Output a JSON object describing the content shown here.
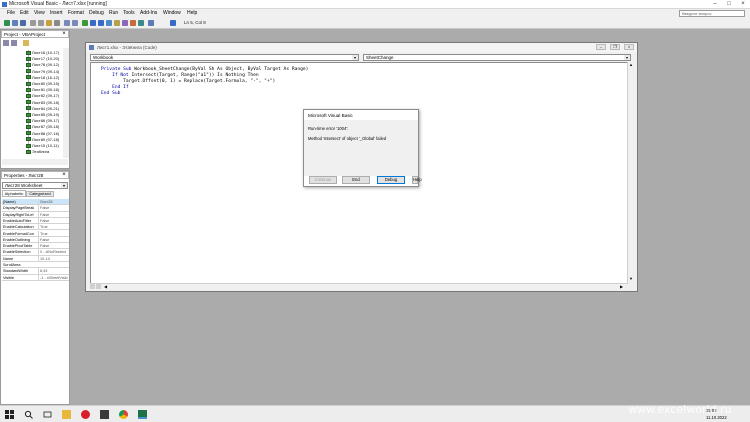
{
  "window": {
    "title": "Microsoft Visual Basic - Лист7.xlsx [running]"
  },
  "menu": [
    "File",
    "Edit",
    "View",
    "Insert",
    "Format",
    "Debug",
    "Run",
    "Tools",
    "Add-Ins",
    "Window",
    "Help"
  ],
  "help_search_placeholder": "Введите вопрос",
  "toolbar": {
    "position_text": "Ln 5, Col 8"
  },
  "project": {
    "title": "Project - VBAProject",
    "items": [
      "Лист16 (10-17)",
      "Лист17 (10-20)",
      "Лист78 (09-12)",
      "Лист79 (09-14)",
      "Лист18 (16-12)",
      "Лист80 (09-15)",
      "Лист81 (09-16)",
      "Лист82 (09-17)",
      "Лист83 (09-18)",
      "Лист84 (09-21)",
      "Лист85 (09-19)",
      "Лист86 (09-17)",
      "Лист87 (09-18)",
      "Лист88 (07-16)",
      "Лист89 (07-18)",
      "Лист15 (10-11)",
      "ЭтаКнига"
    ]
  },
  "properties": {
    "title": "Properties - Лист28",
    "object_select": "Лист28 Worksheet",
    "tabs": [
      "Alphabetic",
      "Categorized"
    ],
    "rows": [
      {
        "name": "(Name)",
        "value": "Лист28"
      },
      {
        "name": "DisplayPageBreak",
        "value": "False"
      },
      {
        "name": "DisplayRightToLef",
        "value": "False"
      },
      {
        "name": "EnableAutoFilter",
        "value": "False"
      },
      {
        "name": "EnableCalculation",
        "value": "True"
      },
      {
        "name": "EnableFormatCon",
        "value": "True"
      },
      {
        "name": "EnableOutlining",
        "value": "False"
      },
      {
        "name": "EnablePivotTable",
        "value": "False"
      },
      {
        "name": "EnableSelection",
        "value": "0 - xlNoRestrict"
      },
      {
        "name": "Name",
        "value": "10-14"
      },
      {
        "name": "ScrollArea",
        "value": ""
      },
      {
        "name": "StandardWidth",
        "value": "8,43"
      },
      {
        "name": "Visible",
        "value": "-1 - xlSheetVisib"
      }
    ]
  },
  "codewin": {
    "title": "Лист1.xlsx - ЭтаКнига (Code)",
    "object_combo": "Workbook",
    "proc_combo": "SheetChange",
    "lines": [
      {
        "kw": "Private Sub ",
        "rest": "Workbook_SheetChange(ByVal Sh As Object, ByVal Target As Range)"
      },
      {
        "kw": "    If Not ",
        "rest": "Intersect(Target, Range(\"a1\")) Is Nothing Then"
      },
      {
        "kw": "",
        "rest": "        Target.Offset(0, 1) = Replace(Target.Formula, \"-\", \"+\")"
      },
      {
        "kw": "    End If",
        "rest": ""
      },
      {
        "kw": "End Sub",
        "rest": ""
      }
    ]
  },
  "dialog": {
    "title": "Microsoft Visual Basic",
    "error_line": "Run-time error '1004':",
    "message": "Method 'Intersect' of object '_Global' failed",
    "buttons": [
      "Continue",
      "End",
      "Debug",
      "Help"
    ]
  },
  "taskbar": {
    "time": "15:03",
    "date": "11.10.2022"
  },
  "watermark": "www.excelworld.ru",
  "colors": {
    "keyword": "#0000a0",
    "accent": "#0078d7"
  }
}
